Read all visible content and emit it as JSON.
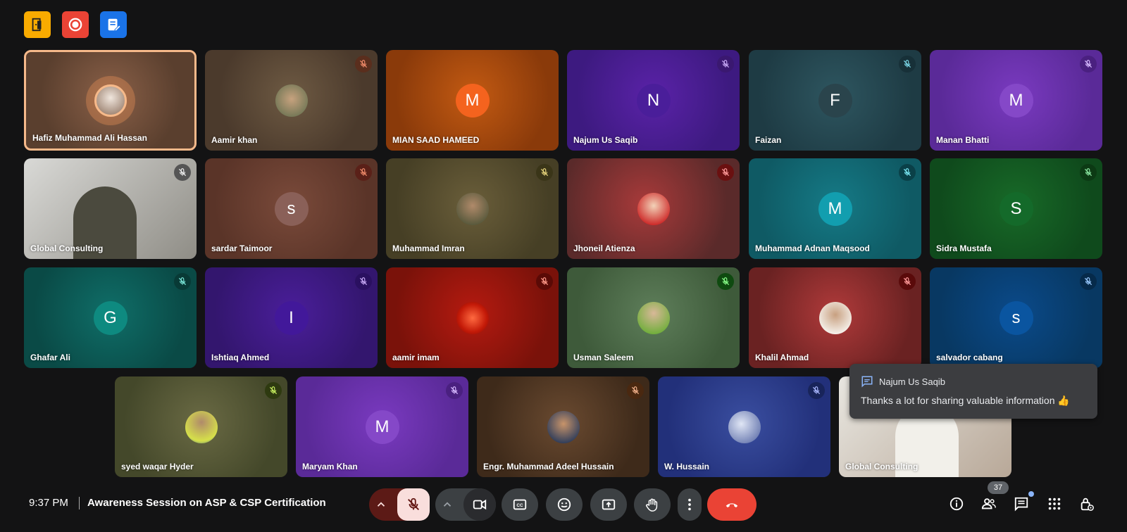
{
  "top_toolbar": {
    "exit_icon": "door-exit-icon",
    "record_icon": "record-icon",
    "notes_icon": "notes-edit-icon"
  },
  "participants": [
    {
      "name": "Hafiz Muhammad Ali Hassan"
    },
    {
      "name": "Aamir khan"
    },
    {
      "name": "MIAN SAAD HAMEED",
      "initial": "M"
    },
    {
      "name": "Najum Us Saqib",
      "initial": "N"
    },
    {
      "name": "Faizan",
      "initial": "F"
    },
    {
      "name": "Manan Bhatti",
      "initial": "M"
    },
    {
      "name": "Global Consulting"
    },
    {
      "name": "sardar Taimoor",
      "initial": "s"
    },
    {
      "name": "Muhammad Imran"
    },
    {
      "name": "Jhoneil Atienza"
    },
    {
      "name": "Muhammad Adnan Maqsood",
      "initial": "M"
    },
    {
      "name": "Sidra Mustafa",
      "initial": "S"
    },
    {
      "name": "Ghafar Ali",
      "initial": "G"
    },
    {
      "name": "Ishtiaq Ahmed",
      "initial": "I"
    },
    {
      "name": "aamir imam"
    },
    {
      "name": "Usman Saleem"
    },
    {
      "name": "Khalil Ahmad"
    },
    {
      "name": "salvador cabang",
      "initial": "s"
    },
    {
      "name": "syed waqar Hyder"
    },
    {
      "name": "Maryam Khan",
      "initial": "M"
    },
    {
      "name": "Engr. Muhammad Adeel Hussain"
    },
    {
      "name": "W. Hussain"
    },
    {
      "name": "Global Consulting"
    }
  ],
  "chat_toast": {
    "sender": "Najum Us Saqib",
    "message": "Thanks a lot for sharing valuable information 👍"
  },
  "bottom_bar": {
    "time": "9:37 PM",
    "meeting_title": "Awareness Session on ASP & CSP Certification",
    "participant_count": "37"
  },
  "colors": {
    "background": "#131314",
    "end_call": "#ea4335",
    "control": "#3c4043",
    "mic_off_bg": "#f9dedc"
  }
}
